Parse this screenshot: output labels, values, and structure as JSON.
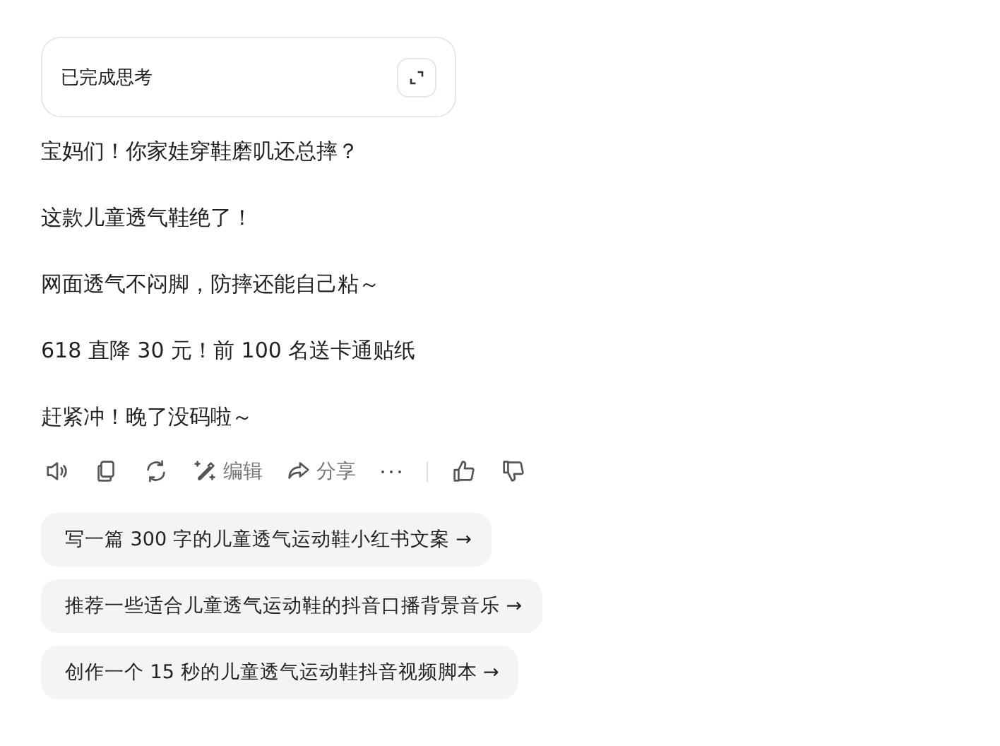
{
  "thinking_card": {
    "label": "已完成思考"
  },
  "paragraphs": [
    "宝妈们！你家娃穿鞋磨叽还总摔？",
    "这款儿童透气鞋绝了！",
    "网面透气不闷脚，防摔还能自己粘～",
    "618 直降 30 元！前 100 名送卡通贴纸",
    "赶紧冲！晚了没码啦～"
  ],
  "actions": [
    {
      "kind": "speaker"
    },
    {
      "kind": "copy"
    },
    {
      "kind": "refresh"
    },
    {
      "kind": "edit",
      "label": "编辑"
    },
    {
      "kind": "share",
      "label": "分享"
    },
    {
      "kind": "more"
    }
  ],
  "feedback": [
    {
      "kind": "like"
    },
    {
      "kind": "dislike"
    }
  ],
  "suggestions": [
    "写一篇 300 字的儿童透气运动鞋小红书文案 →",
    "推荐一些适合儿童透气运动鞋的抖音口播背景音乐 →",
    "创作一个 15 秒的儿童透气运动鞋抖音视频脚本 →"
  ]
}
